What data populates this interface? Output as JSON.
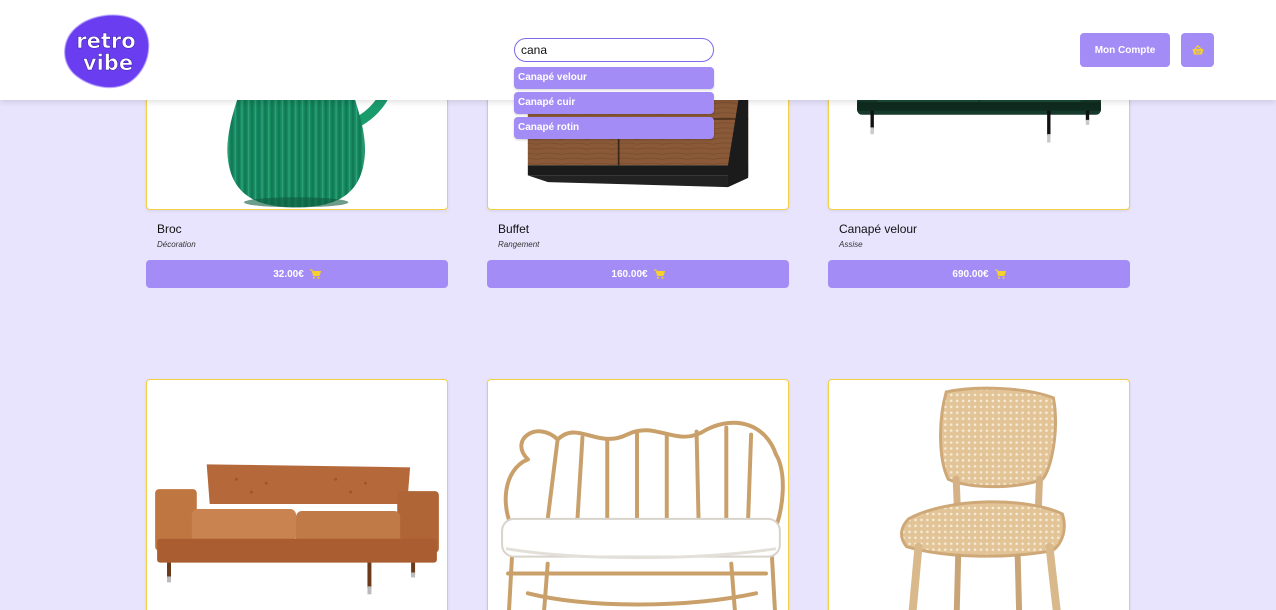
{
  "brand": {
    "logo_line1": "retro",
    "logo_line2": "vibe"
  },
  "search": {
    "value": "cana",
    "placeholder": ""
  },
  "suggestions": [
    "Canapé velour",
    "Canapé cuir",
    "Canapé rotin"
  ],
  "header": {
    "account_label": "Mon Compte",
    "cart_icon": "basket-icon"
  },
  "colors": {
    "accent": "#a38cf6",
    "background": "#e8e4fd",
    "card_border": "#f3cf46",
    "cart_icon": "#f7d02a",
    "logo": "#6a3df0"
  },
  "products": [
    {
      "title": "Broc",
      "category": "Décoration",
      "price": "32.00€"
    },
    {
      "title": "Buffet",
      "category": "Rangement",
      "price": "160.00€"
    },
    {
      "title": "Canapé velour",
      "category": "Assise",
      "price": "690.00€"
    },
    {
      "title": "",
      "category": "",
      "price": ""
    },
    {
      "title": "",
      "category": "",
      "price": ""
    },
    {
      "title": "",
      "category": "",
      "price": ""
    }
  ]
}
